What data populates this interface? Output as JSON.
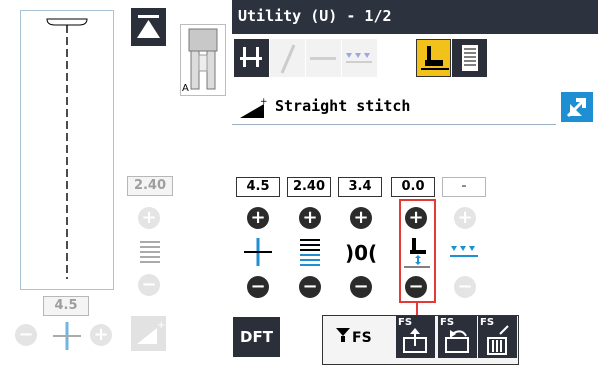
{
  "header": {
    "title": "Utility (U) - 1/2"
  },
  "stitch": {
    "name": "Straight stitch"
  },
  "presser_foot": {
    "letter": "A"
  },
  "left_panel": {
    "length_value": "2.40",
    "width_value": "4.5"
  },
  "settings": [
    {
      "name": "width",
      "value": "4.5"
    },
    {
      "name": "length",
      "value": "2.40"
    },
    {
      "name": "tension",
      "value": "3.4"
    },
    {
      "name": "pivot-height",
      "value": "0.0"
    },
    {
      "name": "free-motion",
      "value": "-"
    }
  ],
  "bottom": {
    "dft_label": "DFT",
    "fs_label": "FS",
    "fs_small": "FS"
  },
  "colors": {
    "title_bar": "#2d323f",
    "tab_selected": "#f2c21b",
    "accent_blue": "#1f8fd4",
    "highlight": "#e53935"
  }
}
